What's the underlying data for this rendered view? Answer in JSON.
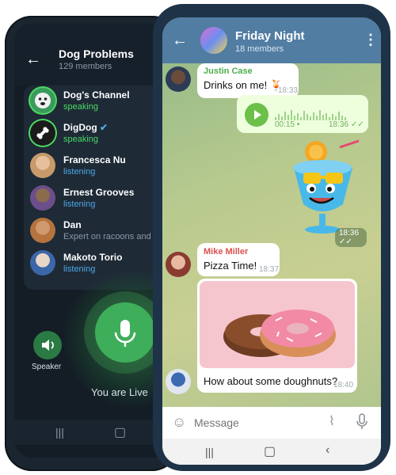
{
  "voice_chat": {
    "title": "Dog Problems",
    "subtitle": "129 members",
    "members": [
      {
        "name": "Dog's Channel",
        "status": "speaking",
        "kind": "speaking",
        "color": "#3a9b5c"
      },
      {
        "name": "DigDog",
        "status": "speaking",
        "kind": "speaking",
        "color": "#1b1b1b"
      },
      {
        "name": "Francesca Nu",
        "status": "listening",
        "kind": "listening",
        "color": "#c89a6a"
      },
      {
        "name": "Ernest Grooves",
        "status": "listening",
        "kind": "listening",
        "color": "#6b4e8a"
      },
      {
        "name": "Dan",
        "status": "Expert on racoons and pi",
        "kind": "muted",
        "color": "#b5733e"
      },
      {
        "name": "Makoto Torio",
        "status": "listening",
        "kind": "listening",
        "color": "#3c66a8"
      }
    ],
    "speaker_label": "Speaker",
    "live_label": "You are Live"
  },
  "chat": {
    "title": "Friday Night",
    "subtitle": "18 members",
    "messages": {
      "m1": {
        "sender": "Justin Case",
        "text": "Drinks on me! 🍹",
        "time": "18:33"
      },
      "m2": {
        "duration": "00:15",
        "time": "18:36",
        "progress": 0
      },
      "m3": {
        "time": "18:36"
      },
      "m4": {
        "sender": "Mike Miller",
        "text": "Pizza Time!",
        "time": "18:37"
      },
      "m5": {
        "text": "How about some doughnuts?",
        "time": "18:40"
      }
    },
    "composer_placeholder": "Message"
  },
  "colors": {
    "header": "#527da3",
    "speaking": "#4cd964",
    "listening": "#4ea6e6",
    "outgoing_bubble": "#eeffde"
  }
}
